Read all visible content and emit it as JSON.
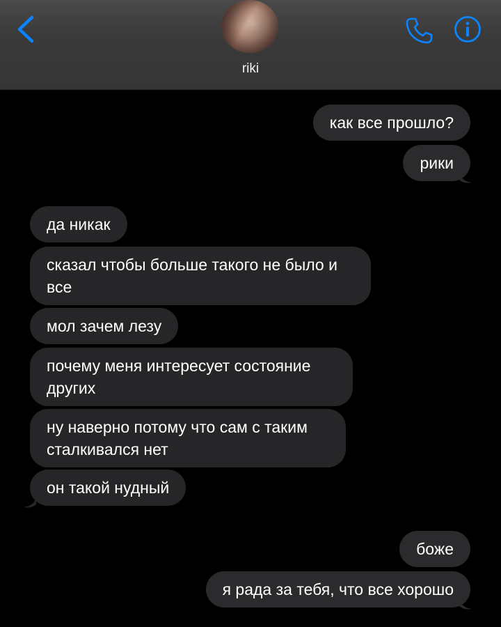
{
  "header": {
    "contact_name": "riki",
    "back_icon": "chevron-left-icon",
    "call_icon": "phone-icon",
    "info_icon": "info-icon",
    "accent_color": "#0a84ff"
  },
  "messages": [
    {
      "direction": "sent",
      "text": "как все прошло?"
    },
    {
      "direction": "sent",
      "text": "рики"
    },
    {
      "direction": "received",
      "text": "да никак"
    },
    {
      "direction": "received",
      "text": "сказал чтобы больше такого не было и все"
    },
    {
      "direction": "received",
      "text": "мол зачем лезу"
    },
    {
      "direction": "received",
      "text": "почему меня интересует состояние других"
    },
    {
      "direction": "received",
      "text": "ну наверно потому что сам с таким сталкивался нет"
    },
    {
      "direction": "received",
      "text": "он такой нудный"
    },
    {
      "direction": "sent",
      "text": "боже"
    },
    {
      "direction": "sent",
      "text": "я рада за тебя, что все хорошо"
    }
  ]
}
